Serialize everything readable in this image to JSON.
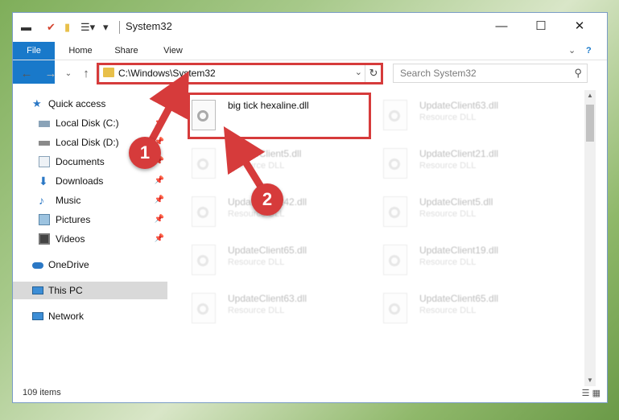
{
  "window": {
    "title": "System32"
  },
  "ribbon": {
    "tabs": [
      "File",
      "Home",
      "Share",
      "View"
    ]
  },
  "address": {
    "path": "C:\\Windows\\System32"
  },
  "search": {
    "placeholder": "Search System32"
  },
  "nav": {
    "items": [
      {
        "label": "Quick access",
        "icon": "star-icon"
      },
      {
        "label": "Local Disk (C:)",
        "icon": "drive-icon"
      },
      {
        "label": "Local Disk (D:)",
        "icon": "drive-icon"
      },
      {
        "label": "Documents",
        "icon": "documents-icon"
      },
      {
        "label": "Downloads",
        "icon": "download-icon"
      },
      {
        "label": "Music",
        "icon": "music-icon"
      },
      {
        "label": "Pictures",
        "icon": "pictures-icon"
      },
      {
        "label": "Videos",
        "icon": "videos-icon"
      },
      {
        "label": "OneDrive",
        "icon": "cloud-icon"
      },
      {
        "label": "This PC",
        "icon": "pc-icon"
      },
      {
        "label": "Network",
        "icon": "network-icon"
      }
    ]
  },
  "files": {
    "highlighted": {
      "name": "big tick hexaline.dll"
    },
    "left": [
      {
        "name": "UpdateClient5.dll",
        "type": "Resource DLL"
      },
      {
        "name": "UpdateClient42.dll",
        "type": "Resource DLL"
      },
      {
        "name": "UpdateClient65.dll",
        "type": "Resource DLL"
      },
      {
        "name": "UpdateClient63.dll",
        "type": "Resource DLL"
      }
    ],
    "right": [
      {
        "name": "UpdateClient63.dll",
        "type": "Resource DLL"
      },
      {
        "name": "UpdateClient21.dll",
        "type": "Resource DLL"
      },
      {
        "name": "UpdateClient5.dll",
        "type": "Resource DLL"
      },
      {
        "name": "UpdateClient19.dll",
        "type": "Resource DLL"
      },
      {
        "name": "UpdateClient65.dll",
        "type": "Resource DLL"
      }
    ]
  },
  "status": {
    "items": "109 items"
  },
  "callouts": [
    "1",
    "2"
  ],
  "colors": {
    "accent": "#1979ca",
    "annotation": "#d63b3b"
  }
}
